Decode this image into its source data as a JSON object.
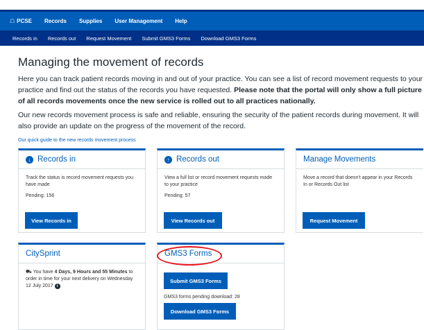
{
  "nav_main": {
    "items": [
      {
        "label": "PCSE",
        "icon": "home-icon"
      },
      {
        "label": "Records"
      },
      {
        "label": "Supplies"
      },
      {
        "label": "User Management"
      },
      {
        "label": "Help"
      }
    ]
  },
  "nav_sub": {
    "items": [
      "Records in",
      "Records out",
      "Request Movement",
      "Submit GMS3 Forms",
      "Download GMS3 Forms"
    ]
  },
  "page": {
    "title": "Managing the movement of records",
    "intro_plain": "Here you can track patient records moving in and out of your practice. You can see a list of record movement requests to your practice and find out the status of the records you have requested.",
    "intro_bold": "Please note that the portal will only show a full picture of all records movements once the new service is rolled out to all practices nationally.",
    "intro2": "Our new records movement process is safe and reliable, ensuring the security of the patient records during movement. It will also provide an update on the progress of the movement of the record.",
    "guide_link": "Our quick guide to the new records movement process"
  },
  "cards": {
    "records_in": {
      "title": "Records in",
      "description": "Track the status is record movement requests you have made",
      "pending": "Pending: 156",
      "button": "View Records in"
    },
    "records_out": {
      "title": "Records out",
      "description": "View a full list or record movement requests made to your practice",
      "pending": "Pending: 57",
      "button": "View Records out"
    },
    "manage": {
      "title": "Manage Movements",
      "description": "Move a record that doesn't appear in your Records In or Records Out list",
      "button": "Request Movement"
    },
    "citysprint": {
      "title": "CitySprint",
      "text_before": "You have",
      "text_bold": "4 Days, 9 Hours and 55 Minutes",
      "text_after": "to order in time for your next delivery on Wednesday 12 July 2017"
    },
    "gms3": {
      "title": "GMS3 Forms",
      "submit_button": "Submit GMS3 Forms",
      "pending": "GMS3 forms pending download: 28",
      "download_button": "Download GMS3 Forms"
    }
  },
  "colors": {
    "nav_blue": "#005eb8",
    "nav_dark": "#003087",
    "highlight_red": "#e8141b"
  }
}
